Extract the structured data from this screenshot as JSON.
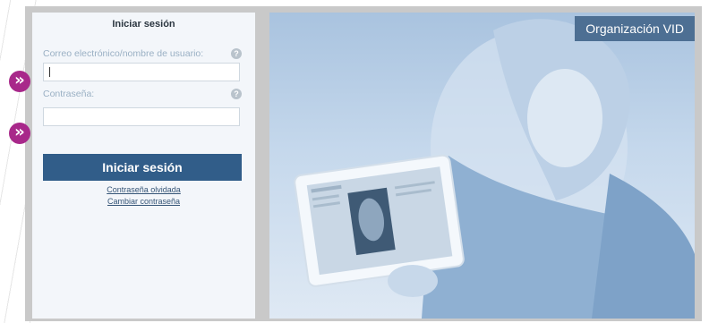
{
  "login": {
    "title": "Iniciar sesión",
    "username_label": "Correo electrónico/nombre de usuario:",
    "username_value": "",
    "password_label": "Contraseña:",
    "password_value": "",
    "help_icon": "?",
    "submit_label": "Iniciar sesión",
    "forgot_link": "Contraseña olvidada",
    "change_link": "Cambiar contraseña"
  },
  "hero": {
    "org_name": "Organización VID"
  },
  "markers": {
    "symbol": "»",
    "color": "#a8288a"
  },
  "colors": {
    "primary_button": "#315d89",
    "org_badge": "#4d6f93"
  }
}
